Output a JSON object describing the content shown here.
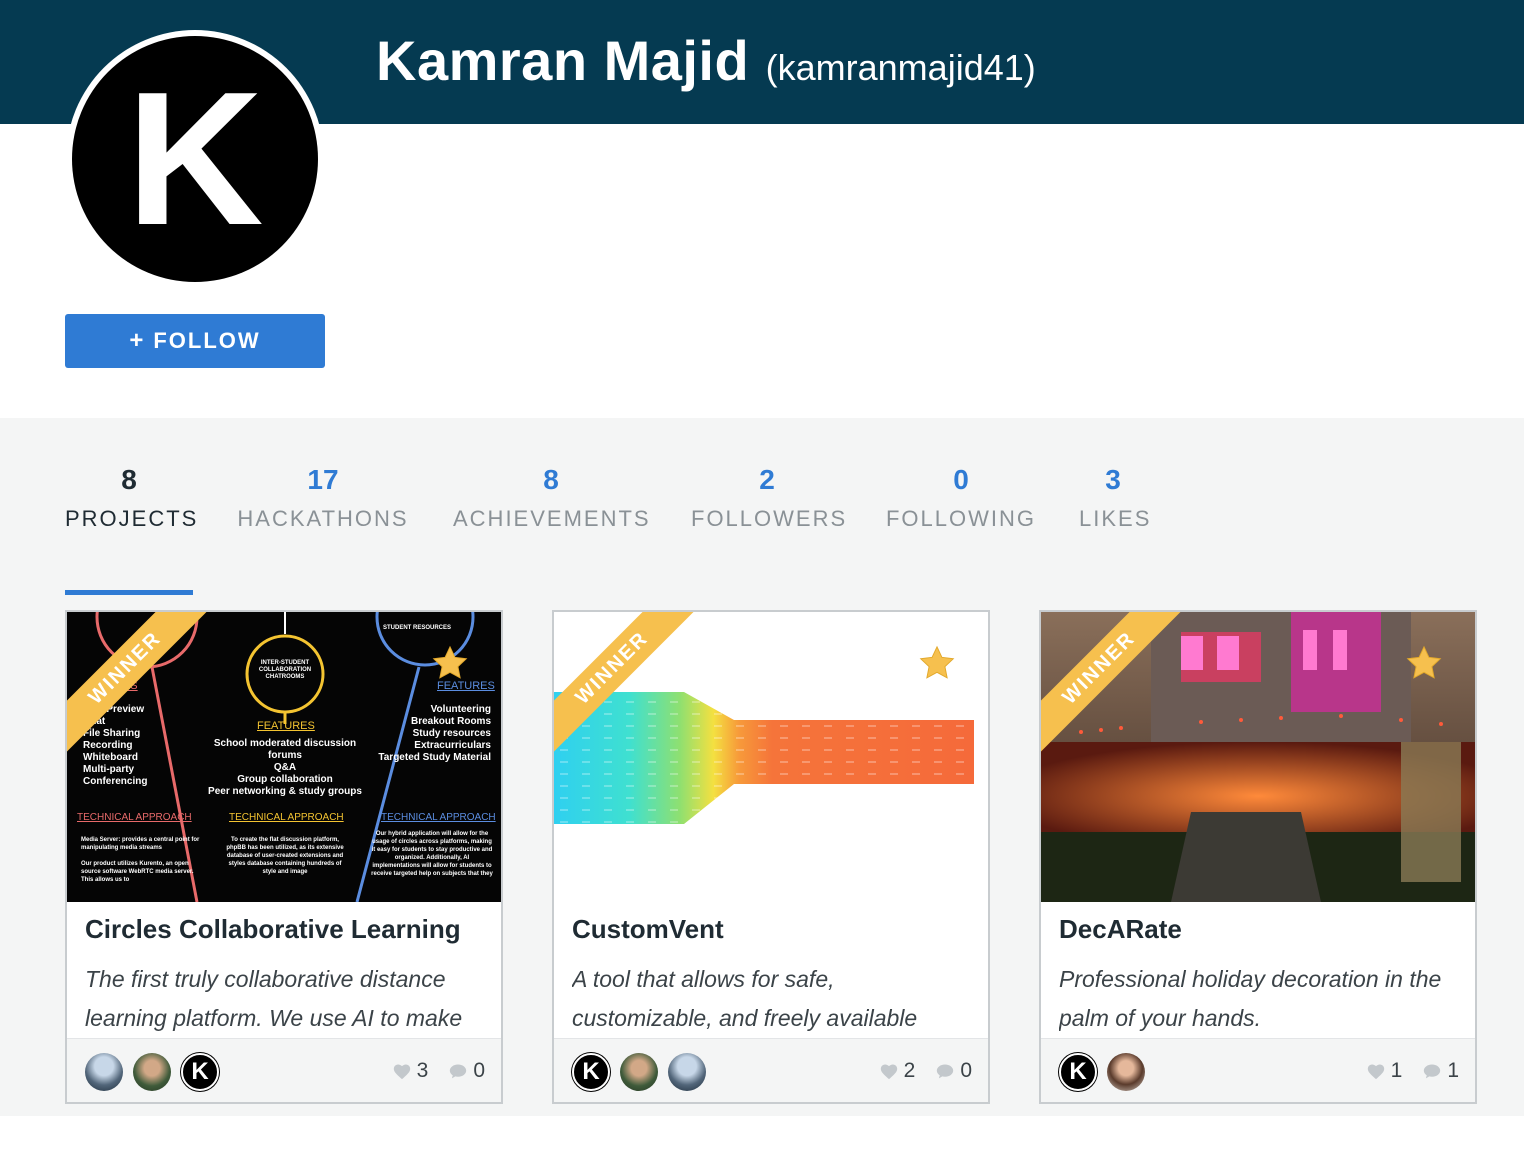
{
  "profile": {
    "name": "Kamran Majid",
    "handle": "(kamranmajid41)",
    "avatar_letter": "K",
    "follow_label": "FOLLOW",
    "follow_icon": "+"
  },
  "stats": [
    {
      "value": "8",
      "label": "PROJECTS",
      "active": true
    },
    {
      "value": "17",
      "label": "HACKATHONS"
    },
    {
      "value": "8",
      "label": "ACHIEVEMENTS"
    },
    {
      "value": "2",
      "label": "FOLLOWERS"
    },
    {
      "value": "0",
      "label": "FOLLOWING"
    },
    {
      "value": "3",
      "label": "LIKES"
    }
  ],
  "projects": [
    {
      "title": "Circles Collaborative Learning",
      "tagline": "The first truly collaborative distance learning platform. We use AI to make",
      "ribbon": "WINNER",
      "likes": "3",
      "comments": "0",
      "thumb_text": {
        "chatrooms": "INTER-STUDENT COLLABORATION CHATROOMS",
        "student_resources": "STUDENT RESOURCES",
        "features": "FEATURES",
        "features_left": "RES",
        "left_list": "ideo Preview\nChat\nFile Sharing\nRecording\nWhiteboard\nMulti-party\nConferencing",
        "mid_list": "School moderated discussion forums\nQ&A\nGroup collaboration\nPeer networking & study groups",
        "right_list": "Volunteering\nBreakout Rooms\nStudy resources\nExtracurriculars\nTargeted Study Material",
        "tech": "TECHNICAL APPROACH",
        "tech_left": "Media Server: provides a central point for manipulating media streams\n\nOur product utilizes Kurento, an open source software WebRTC media server. This allows us to",
        "tech_mid": "To create the flat discussion platform, phpBB has been utilized, as its extensive database of user-created extensions and styles database containing hundreds of style and image",
        "tech_right": "Our hybrid application will allow for the usage of circles across platforms, making it easy for students to stay productive and organized. Additionally, AI implementations will allow for students to receive targeted help on subjects that they"
      }
    },
    {
      "title": "CustomVent",
      "tagline": "A tool that allows for safe, customizable, and freely available",
      "ribbon": "WINNER",
      "likes": "2",
      "comments": "0"
    },
    {
      "title": "DecARate",
      "tagline": "Professional holiday decoration in the palm of your hands.",
      "ribbon": "WINNER",
      "likes": "1",
      "comments": "1"
    }
  ],
  "colors": {
    "header_bg": "#053a51",
    "accent_blue": "#2f7bd4",
    "ribbon_gold": "#f6c04e",
    "section_bg": "#f4f5f5"
  },
  "icons": [
    "plus-icon",
    "star-icon",
    "heart-icon",
    "comment-icon"
  ]
}
